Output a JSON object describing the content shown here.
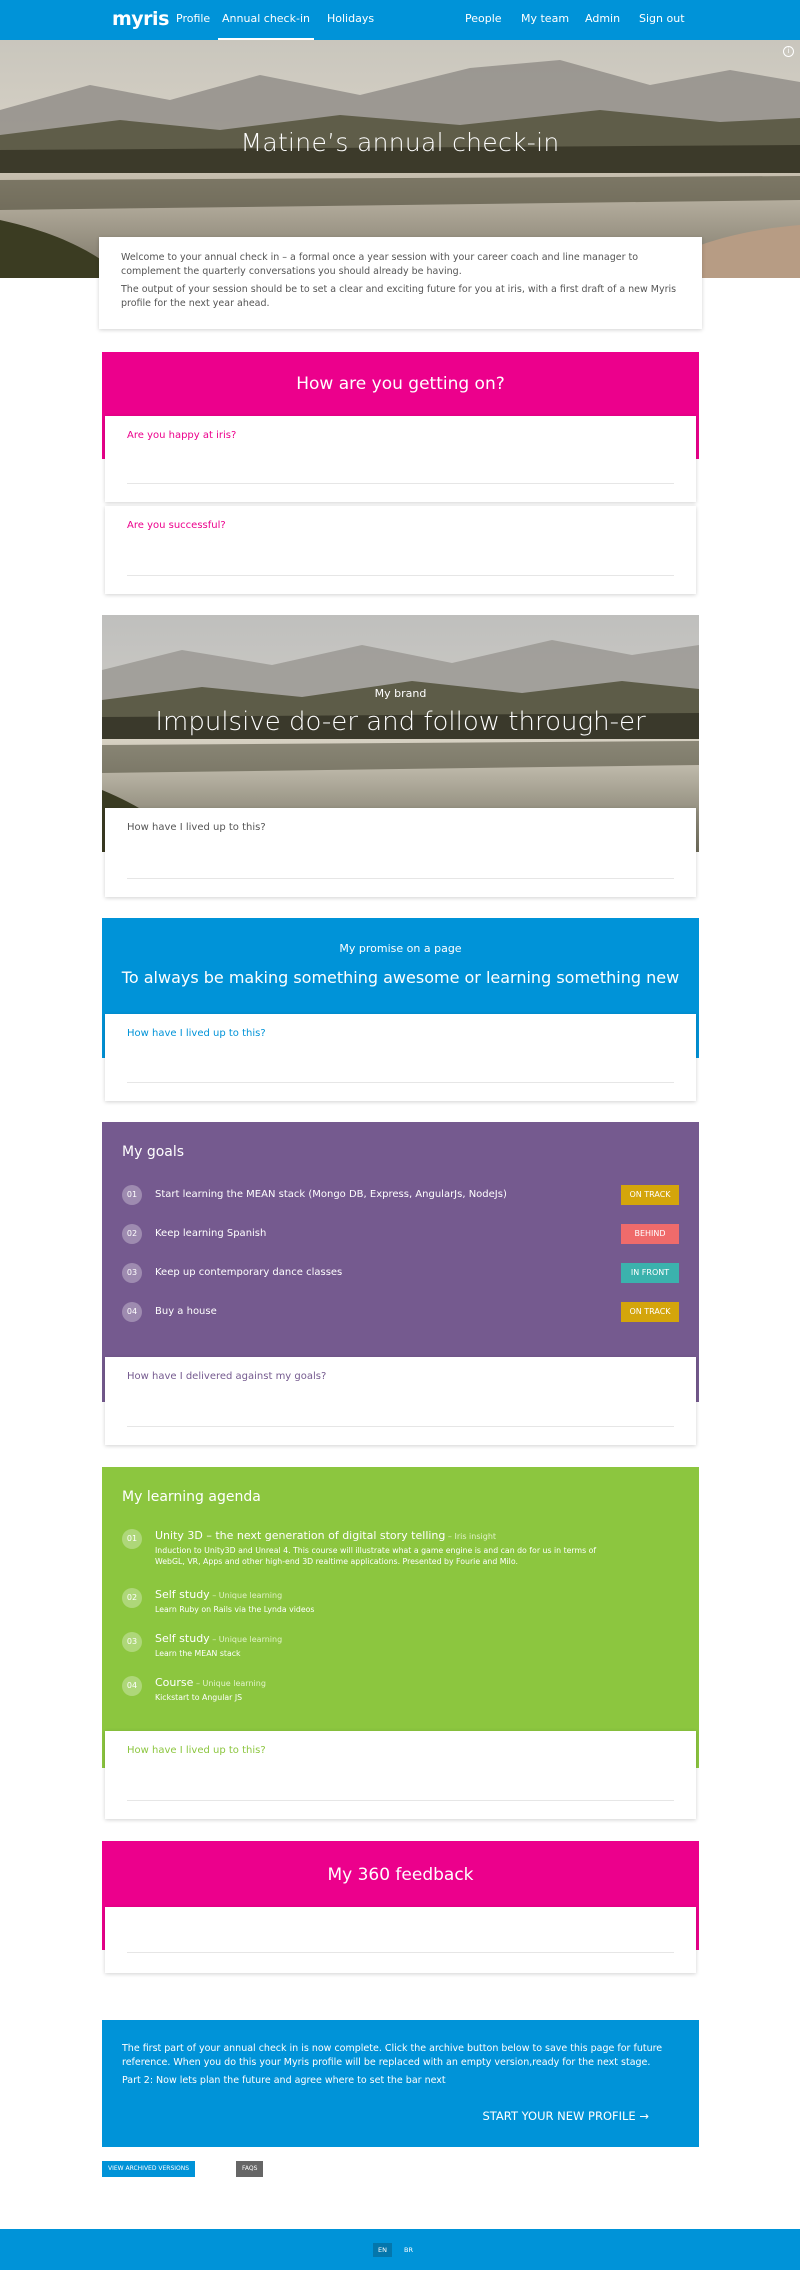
{
  "nav": {
    "logo": "myris",
    "left_links": [
      "Profile",
      "Annual check-in",
      "Holidays"
    ],
    "right_links": [
      "People",
      "My team",
      "Admin",
      "Sign out"
    ],
    "active": "Annual check-in",
    "info_icon": "info-icon"
  },
  "hero": {
    "title": "Matine’s annual check-in",
    "intro": [
      "Welcome to your annual check in – a formal once a year session with your career coach and line manager to complement the quarterly conversations you should already be having.",
      "The output of your session should be to set a clear and exciting future for you at iris, with a first draft of a new Myris profile for the next year ahead."
    ]
  },
  "getting_on": {
    "title": "How are you getting on?",
    "q1": "Are you happy at iris?",
    "q2": "Are you successful?"
  },
  "brand": {
    "label": "My brand",
    "title": "Impulsive do-er and follow through-er",
    "question": "How have I lived up to this?"
  },
  "promise": {
    "label": "My promise on a page",
    "title": "To always be making something awesome or learning something new",
    "question": "How have I lived up to this?"
  },
  "goals": {
    "title": "My goals",
    "items": [
      {
        "num": "01",
        "text": "Start learning the MEAN stack (Mongo DB, Express, AngularJs, NodeJs)",
        "status": "ON TRACK",
        "color": "#d4a50b"
      },
      {
        "num": "02",
        "text": "Keep learning Spanish",
        "status": "BEHIND",
        "color": "#ef6b6b"
      },
      {
        "num": "03",
        "text": "Keep up contemporary dance classes",
        "status": "IN FRONT",
        "color": "#3bb2ad"
      },
      {
        "num": "04",
        "text": "Buy a house",
        "status": "ON TRACK",
        "color": "#d4a50b"
      }
    ],
    "question": "How have I delivered against my goals?"
  },
  "learning": {
    "title": "My learning agenda",
    "items": [
      {
        "num": "01",
        "title": "Unity 3D  –  the next generation of digital story telling",
        "tag": " – Iris insight",
        "desc": "Induction to Unity3D and Unreal 4. This course will illustrate what a game engine is and can do for us in terms of WebGL, VR, Apps and other high-end 3D realtime applications. Presented by Fourie and Milo."
      },
      {
        "num": "02",
        "title": "Self study",
        "tag": " – Unique learning",
        "desc": "Learn Ruby on Rails via the Lynda videos"
      },
      {
        "num": "03",
        "title": "Self study",
        "tag": " – Unique learning",
        "desc": "Learn the MEAN stack"
      },
      {
        "num": "04",
        "title": "Course",
        "tag": " – Unique learning",
        "desc": "Kickstart to Angular JS"
      }
    ],
    "question": "How have I lived up to this?"
  },
  "feedback": {
    "title": "My 360 feedback"
  },
  "archive": {
    "p1": "The first part of your annual check in is now complete. Click the archive button below to save this page for future reference. When you do this your Myris profile will be replaced with an empty version,ready for the next stage.",
    "p2": "Part 2: Now lets plan the future and agree where to set the bar next",
    "cta": "START YOUR NEW PROFILE →"
  },
  "buttons": {
    "archived": "VIEW ARCHIVED VERSIONS",
    "faqs": "FAQS"
  },
  "footer": {
    "langs": [
      "EN",
      "BR"
    ]
  },
  "colors": {
    "blue": "#0093d8",
    "pink": "#ec008c",
    "purple": "#755a8f",
    "green": "#8cc63f"
  }
}
